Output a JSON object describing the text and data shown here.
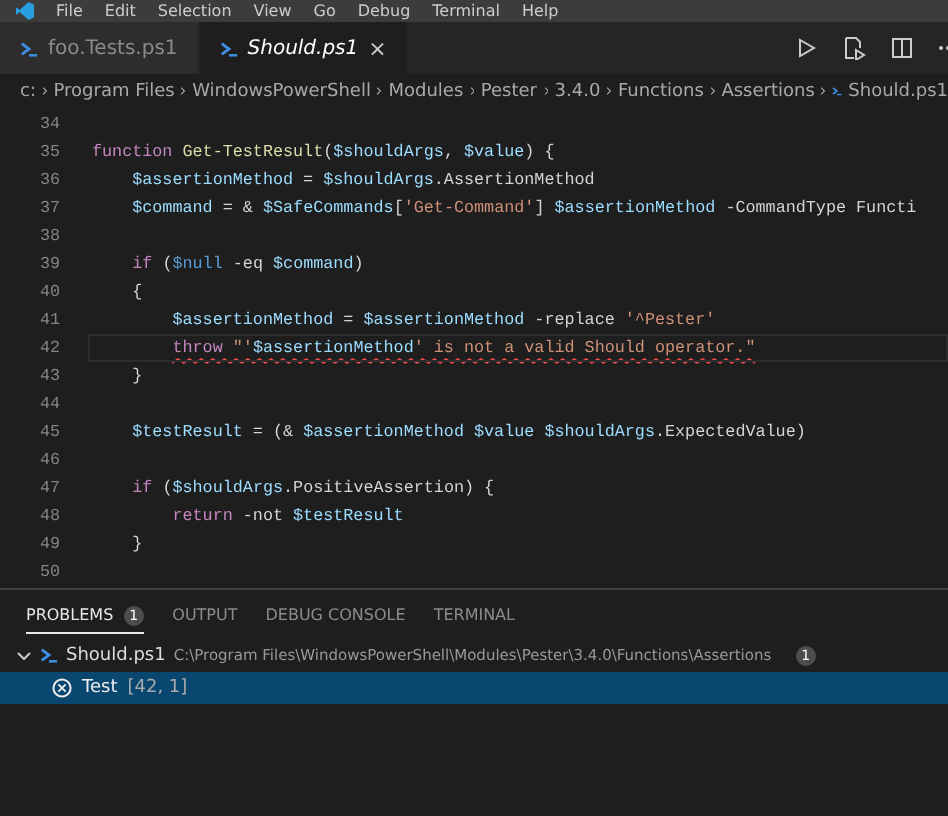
{
  "menu": [
    "File",
    "Edit",
    "Selection",
    "View",
    "Go",
    "Debug",
    "Terminal",
    "Help"
  ],
  "tabs": [
    {
      "label": "foo.Tests.ps1",
      "selected": false,
      "preview": false
    },
    {
      "label": "Should.ps1",
      "selected": true,
      "preview": true,
      "close": "×"
    }
  ],
  "breadcrumb": [
    "c:",
    "Program Files",
    "WindowsPowerShell",
    "Modules",
    "Pester",
    "3.4.0",
    "Functions",
    "Assertions",
    "Should.ps1"
  ],
  "editor": {
    "lines": [
      {
        "number": "34",
        "current": false
      },
      {
        "number": "35",
        "current": false,
        "error": false,
        "tokens": [
          {
            "kind": "keyword",
            "text": "function"
          },
          {
            "kind": "function",
            "text": " Get-TestResult"
          },
          {
            "kind": "plain",
            "text": "("
          },
          {
            "kind": "variable",
            "text": "$shouldArgs"
          },
          {
            "kind": "plain",
            "text": ", "
          },
          {
            "kind": "variable",
            "text": "$value"
          },
          {
            "kind": "plain",
            "text": ") {"
          }
        ]
      },
      {
        "number": "36",
        "current": false,
        "error": false,
        "tokens": [
          {
            "kind": "variable",
            "text": "    $assertionMethod"
          },
          {
            "kind": "plain",
            "text": " = "
          },
          {
            "kind": "variable",
            "text": "$shouldArgs"
          },
          {
            "kind": "plain",
            "text": ".AssertionMethod"
          }
        ]
      },
      {
        "number": "37",
        "current": false,
        "error": false,
        "tokens": [
          {
            "kind": "variable",
            "text": "    $command"
          },
          {
            "kind": "plain",
            "text": " = & "
          },
          {
            "kind": "variable",
            "text": "$SafeCommands"
          },
          {
            "kind": "plain",
            "text": "["
          },
          {
            "kind": "string",
            "text": "'Get-Command'"
          },
          {
            "kind": "plain",
            "text": "] "
          },
          {
            "kind": "variable",
            "text": "$assertionMethod"
          },
          {
            "kind": "plain",
            "text": " -CommandType Functi"
          }
        ]
      },
      {
        "number": "38",
        "current": false
      },
      {
        "number": "39",
        "current": false,
        "error": false,
        "tokens": [
          {
            "kind": "keyword",
            "text": "    if"
          },
          {
            "kind": "plain",
            "text": " ("
          },
          {
            "kind": "constant",
            "text": "$null"
          },
          {
            "kind": "plain",
            "text": " -eq "
          },
          {
            "kind": "variable",
            "text": "$command"
          },
          {
            "kind": "plain",
            "text": ")"
          }
        ]
      },
      {
        "number": "40",
        "current": false,
        "error": false,
        "tokens": [
          {
            "kind": "plain",
            "text": "    {"
          }
        ]
      },
      {
        "number": "41",
        "current": false,
        "error": false,
        "tokens": [
          {
            "kind": "variable",
            "text": "        $assertionMethod"
          },
          {
            "kind": "plain",
            "text": " = "
          },
          {
            "kind": "variable",
            "text": "$assertionMethod"
          },
          {
            "kind": "plain",
            "text": " -replace "
          },
          {
            "kind": "string",
            "text": "'^Pester'"
          }
        ]
      },
      {
        "number": "42",
        "current": true,
        "error": true,
        "tokens": [
          {
            "kind": "keyword",
            "text": "        throw"
          },
          {
            "kind": "string",
            "text": " \"'"
          },
          {
            "kind": "variable",
            "text": "$assertionMethod"
          },
          {
            "kind": "string",
            "text": "' is not a valid Should operator.\""
          }
        ]
      },
      {
        "number": "43",
        "current": false,
        "error": false,
        "tokens": [
          {
            "kind": "plain",
            "text": "    }"
          }
        ]
      },
      {
        "number": "44",
        "current": false
      },
      {
        "number": "45",
        "current": false,
        "error": false,
        "tokens": [
          {
            "kind": "variable",
            "text": "    $testResult"
          },
          {
            "kind": "plain",
            "text": " = (& "
          },
          {
            "kind": "variable",
            "text": "$assertionMethod"
          },
          {
            "kind": "variable",
            "text": " $value"
          },
          {
            "kind": "variable",
            "text": " $shouldArgs"
          },
          {
            "kind": "plain",
            "text": ".ExpectedValue)"
          }
        ]
      },
      {
        "number": "46",
        "current": false
      },
      {
        "number": "47",
        "current": false,
        "error": false,
        "tokens": [
          {
            "kind": "keyword",
            "text": "    if"
          },
          {
            "kind": "plain",
            "text": " ("
          },
          {
            "kind": "variable",
            "text": "$shouldArgs"
          },
          {
            "kind": "plain",
            "text": ".PositiveAssertion) {"
          }
        ]
      },
      {
        "number": "48",
        "current": false,
        "error": false,
        "tokens": [
          {
            "kind": "keyword",
            "text": "        return"
          },
          {
            "kind": "plain",
            "text": " -not "
          },
          {
            "kind": "variable",
            "text": "$testResult"
          }
        ]
      },
      {
        "number": "49",
        "current": false,
        "error": false,
        "tokens": [
          {
            "kind": "plain",
            "text": "    }"
          }
        ]
      },
      {
        "number": "50",
        "current": false
      }
    ]
  },
  "panel": {
    "tabs": [
      {
        "label": "PROBLEMS",
        "selected": true,
        "badge": "1"
      },
      {
        "label": "OUTPUT",
        "selected": false
      },
      {
        "label": "DEBUG CONSOLE",
        "selected": false
      },
      {
        "label": "TERMINAL",
        "selected": false
      }
    ],
    "file": {
      "expanded": true,
      "name": "Should.ps1",
      "path": "C:\\Program Files\\WindowsPowerShell\\Modules\\Pester\\3.4.0\\Functions\\Assertions",
      "count": "1"
    },
    "problems": [
      {
        "message": "Test",
        "location": "[42, 1]",
        "selected": true
      }
    ]
  }
}
